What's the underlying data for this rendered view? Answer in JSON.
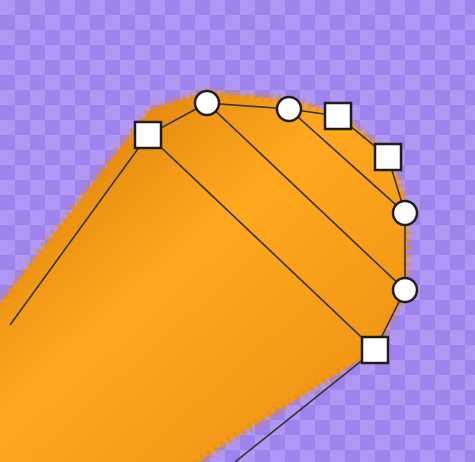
{
  "canvas": {
    "background_color": "#a58af0",
    "pixel_tile_light": "#b7a2f6",
    "pixel_tile_dark": "#9a7ee8",
    "fill_color": "#ea8d0e",
    "fill_highlight": "#ffa81f",
    "fill_shadow": "#d07100",
    "outline_color": "#333333",
    "handle_fill": "#ffffff",
    "handle_stroke": "#1e1e1e"
  },
  "editor": {
    "tool": "shape-edit",
    "control_points": [
      {
        "type": "corner",
        "name": "corner-handle-top-left"
      },
      {
        "type": "smooth",
        "name": "smooth-handle-top-1"
      },
      {
        "type": "smooth",
        "name": "smooth-handle-top-2"
      },
      {
        "type": "corner",
        "name": "corner-handle-top-right"
      },
      {
        "type": "corner",
        "name": "corner-handle-right"
      },
      {
        "type": "smooth",
        "name": "smooth-handle-right-1"
      },
      {
        "type": "smooth",
        "name": "smooth-handle-right-2"
      },
      {
        "type": "corner",
        "name": "corner-handle-bottom-right"
      }
    ]
  }
}
